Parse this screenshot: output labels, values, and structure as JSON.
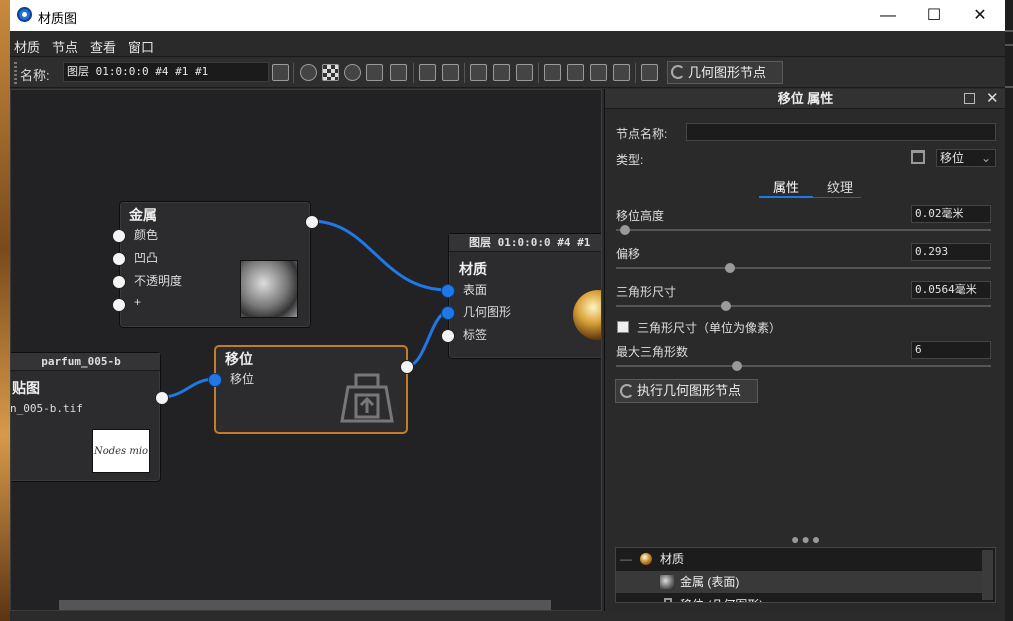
{
  "window": {
    "title": "材质图"
  },
  "menu": [
    "材质",
    "节点",
    "查看",
    "窗口"
  ],
  "toolbar": {
    "name_label": "名称:",
    "name_value": "图层 01:0:0:0 #4 #1 #1",
    "geometry_button": "几何图形节点"
  },
  "nodes": {
    "metal": {
      "title": "金属",
      "ports": [
        "颜色",
        "凹凸",
        "不透明度",
        "+"
      ]
    },
    "material": {
      "header": "图层 01:0:0:0 #4 #1",
      "title": "材质",
      "ports": [
        "表面",
        "几何图形",
        "标签"
      ]
    },
    "displace": {
      "title": "移位",
      "ports": [
        "移位"
      ]
    },
    "texture": {
      "header": "parfum_005-b",
      "title": "贴图",
      "file": "n_005-b.tif",
      "thumb_text": "Nodes mio"
    }
  },
  "panel": {
    "title": "移位 属性",
    "node_name_label": "节点名称:",
    "node_name_value": "",
    "type_label": "类型:",
    "type_value": "移位",
    "tabs": [
      "属性",
      "纹理"
    ],
    "props": [
      {
        "label": "移位高度",
        "value": "0.02毫米",
        "level": 0.01
      },
      {
        "label": "偏移",
        "value": "0.293",
        "level": 0.29
      },
      {
        "label": "三角形尺寸",
        "value": "0.0564毫米",
        "level": 0.28
      },
      {
        "label": "最大三角形数",
        "value": "6",
        "level": 0.31
      }
    ],
    "checkbox_label": "三角形尺寸（单位为像素）",
    "exec_button": "执行几何图形节点",
    "tree": [
      {
        "label": "材质"
      },
      {
        "label": "金属 (表面)"
      },
      {
        "label": "移位 (几何图形)"
      }
    ]
  },
  "colors": {
    "accent": "#1f78e6",
    "selected_node": "#c77a2a"
  }
}
